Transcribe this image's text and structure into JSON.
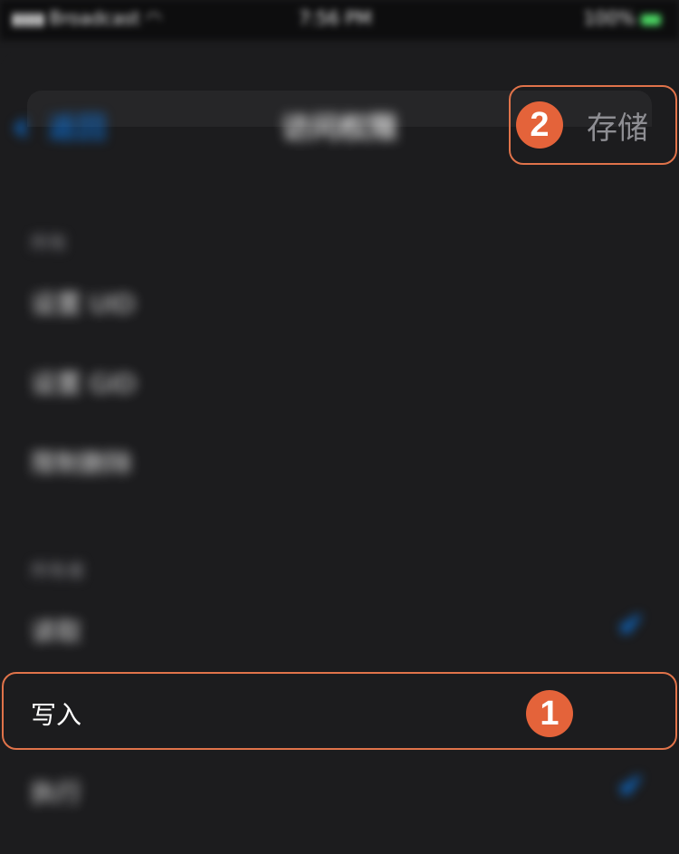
{
  "status_bar": {
    "carrier": "Broadcast",
    "time": "7:56 PM",
    "battery": "100%"
  },
  "nav": {
    "back_label": "返回",
    "title": "访问权限",
    "save_label": "存储"
  },
  "sections": [
    {
      "header": "所有",
      "rows": [
        {
          "label": "设置 UID"
        },
        {
          "label": "设置 GID"
        },
        {
          "label": "限制删除"
        }
      ]
    },
    {
      "header": "所有者",
      "rows": [
        {
          "label": "读取",
          "checked": true
        },
        {
          "label": "写入",
          "checked": false
        },
        {
          "label": "执行",
          "checked": true
        }
      ]
    }
  ],
  "annotations": {
    "step1": "1",
    "step2": "2",
    "highlight_color": "#e0734a",
    "badge_color": "#e4633a"
  },
  "colors": {
    "background": "#1c1c1e",
    "accent": "#0a84ff",
    "secondary_text": "#8e8e93"
  }
}
